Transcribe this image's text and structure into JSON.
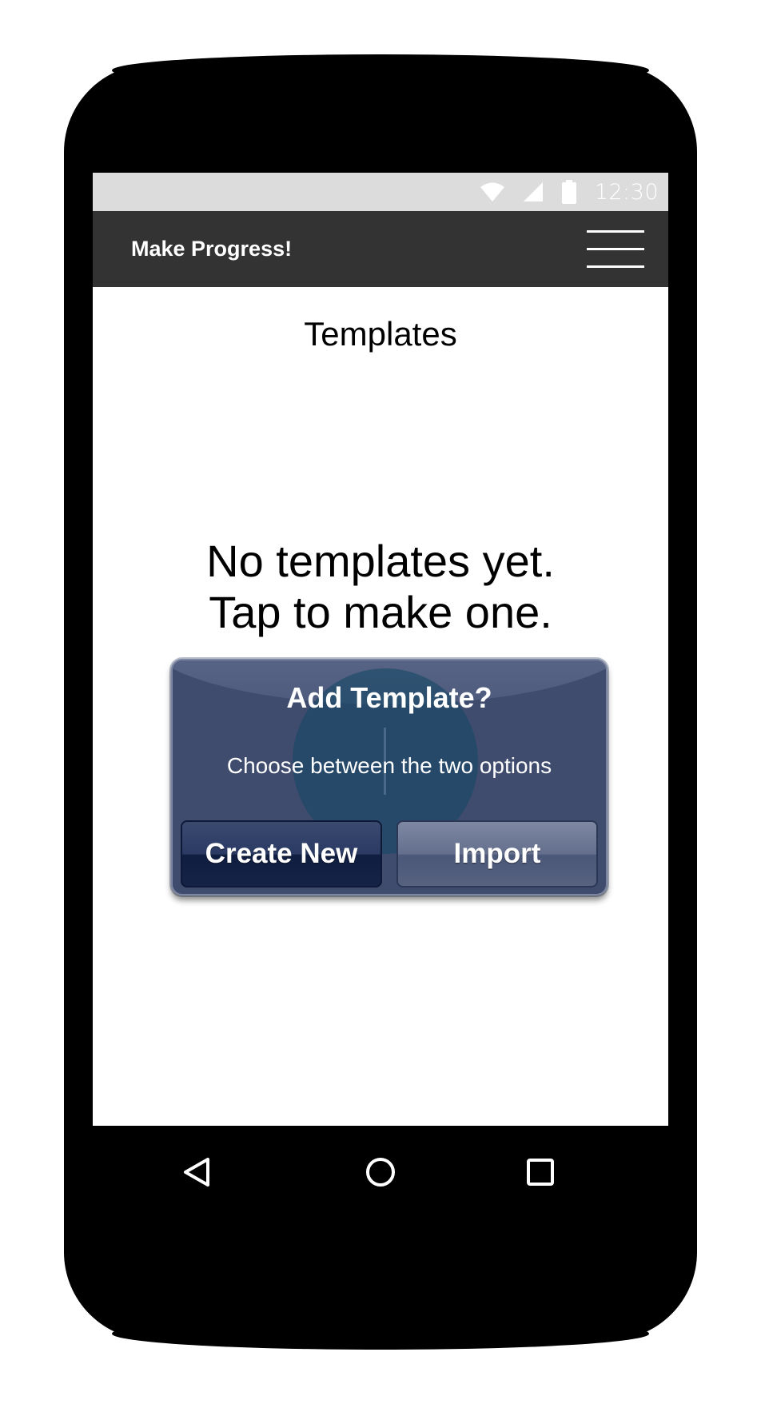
{
  "status_bar": {
    "time": "12:30",
    "icons": [
      "wifi-icon",
      "cell-signal-icon",
      "battery-icon"
    ]
  },
  "app_bar": {
    "title": "Make Progress!",
    "menu_icon": "hamburger-menu-icon"
  },
  "main": {
    "page_title": "Templates",
    "empty_line1": "No templates yet.",
    "empty_line2": "Tap to make one."
  },
  "dialog": {
    "title": "Add Template?",
    "message": "Choose between the two options",
    "create_label": "Create New",
    "import_label": "Import"
  },
  "nav_bar": {
    "icons": [
      "back-icon",
      "home-icon",
      "recents-icon"
    ]
  },
  "colors": {
    "status_bar": "#dcdcdc",
    "app_bar": "#333333",
    "dialog": "#3f4c6e",
    "phone_body": "#000000"
  }
}
